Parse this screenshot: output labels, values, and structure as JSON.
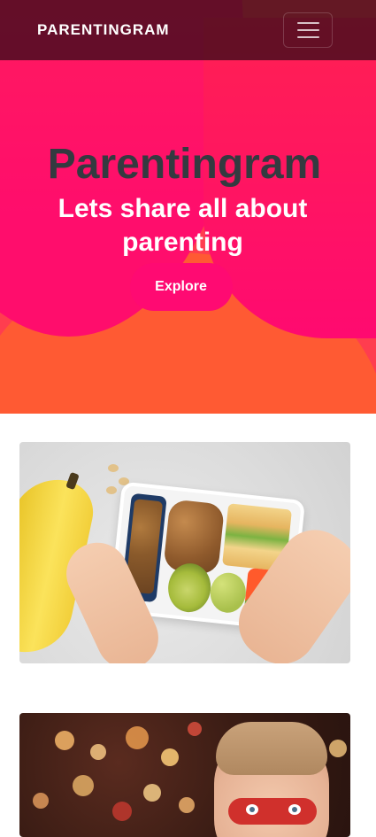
{
  "navbar": {
    "brand": "PARENTINGRAM",
    "menu_icon": "hamburger-menu-icon"
  },
  "hero": {
    "title": "Parentingram",
    "subtitle": "Lets share all about parenting",
    "cta_label": "Explore"
  },
  "cards": [
    {
      "image": "child-eating-lunchbox-photo"
    },
    {
      "image": "child-with-holiday-lights-photo"
    }
  ],
  "colors": {
    "navbar_bg": "#2a0c14",
    "hero_pink": "#ff0a72",
    "hero_orange": "#ff5a33",
    "title_color": "#343a40"
  }
}
